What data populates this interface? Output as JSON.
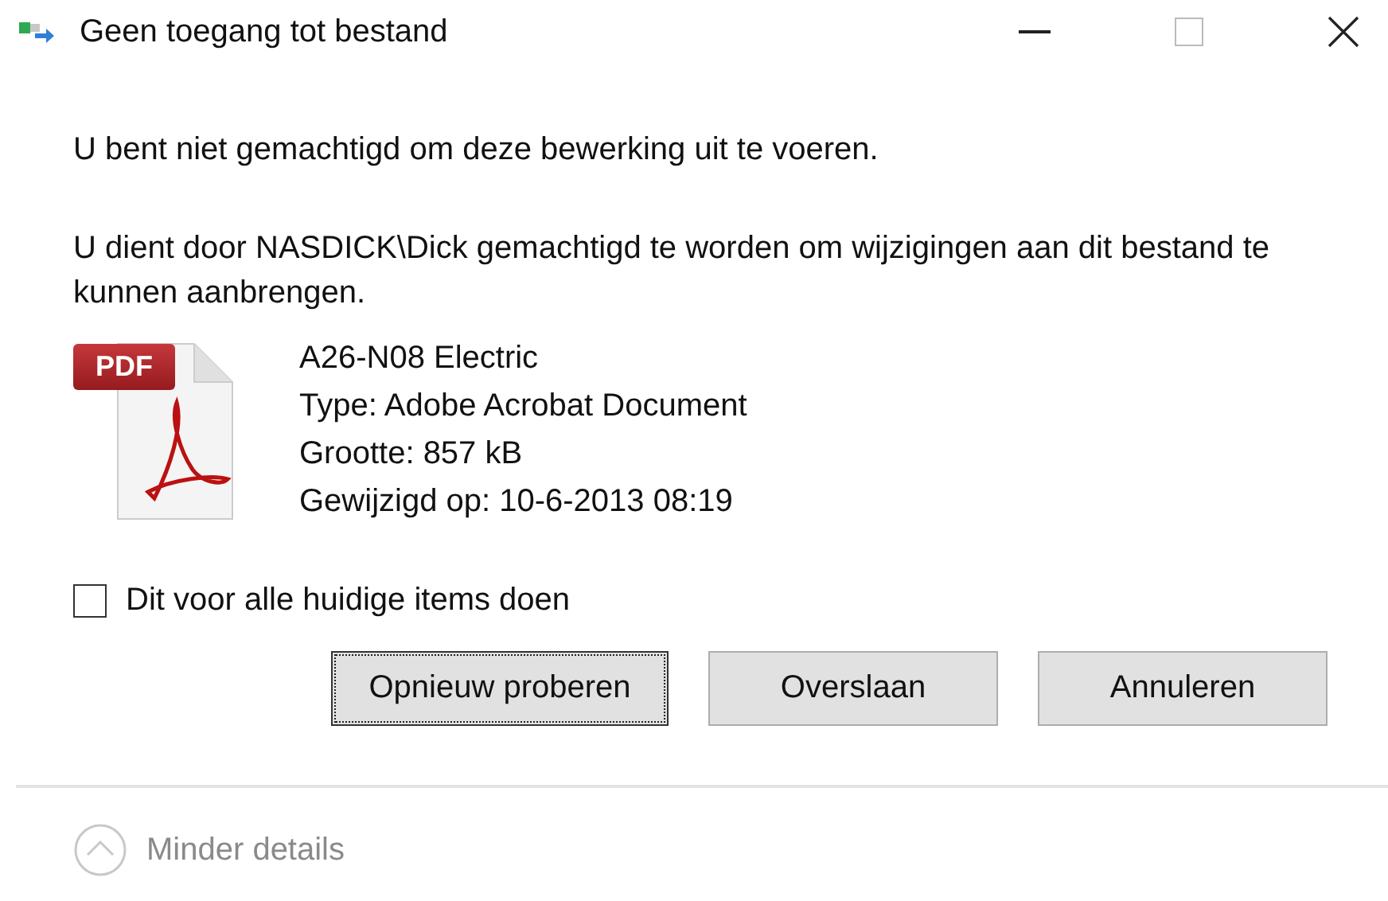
{
  "window": {
    "title": "Geen toegang tot bestand"
  },
  "message": "U bent niet gemachtigd om deze bewerking uit te voeren.",
  "detail": "U dient door NASDICK\\Dick gemachtigd te worden om wijzigingen aan dit bestand te kunnen aanbrengen.",
  "file": {
    "icon_label": "PDF",
    "lines": [
      "A26-N08 Electric",
      "Type: Adobe Acrobat Document",
      "Grootte: 857 kB",
      "Gewijzigd op: 10-6-2013 08:19"
    ]
  },
  "checkbox": {
    "label": "Dit voor alle huidige items doen",
    "checked": false
  },
  "buttons": [
    {
      "label": "Opnieuw proberen",
      "focused": true
    },
    {
      "label": "Overslaan",
      "focused": false
    },
    {
      "label": "Annuleren",
      "focused": false
    }
  ],
  "details_toggle": {
    "label": "Minder details"
  }
}
